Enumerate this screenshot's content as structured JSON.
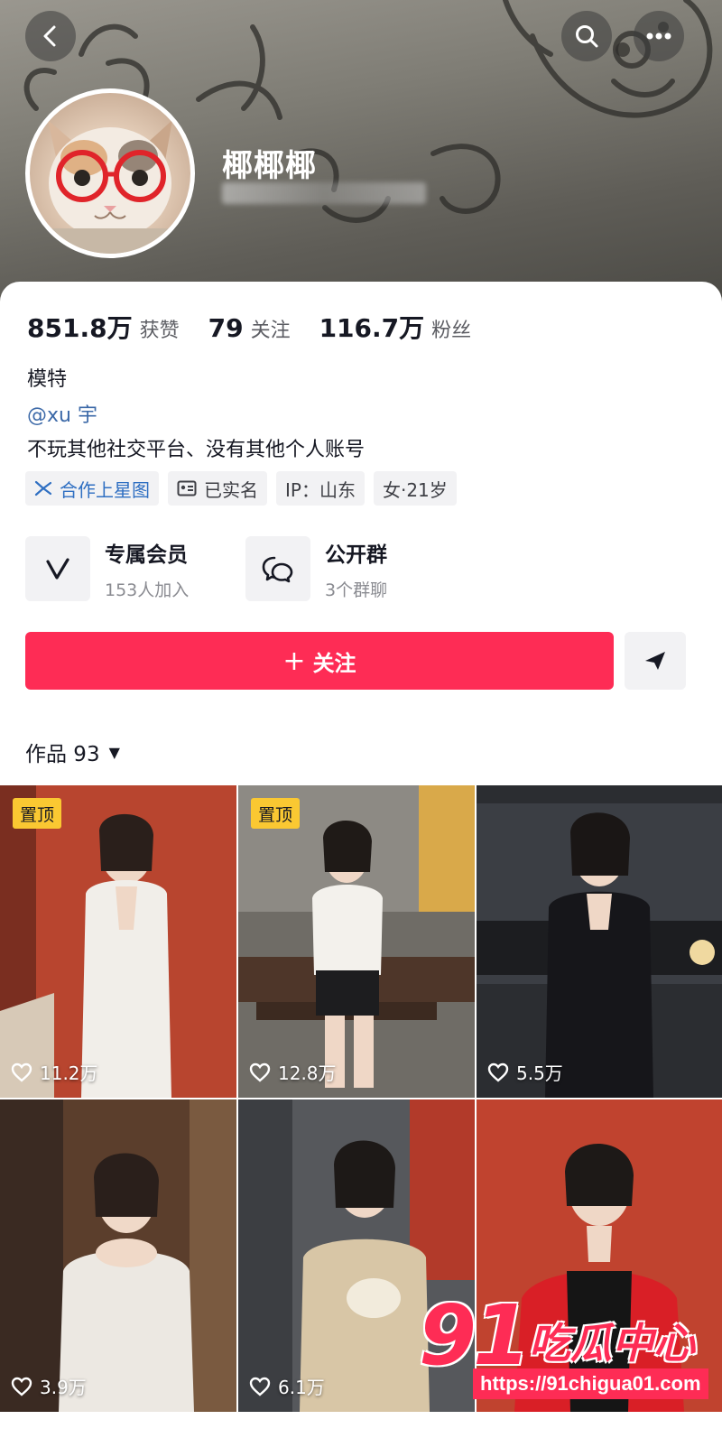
{
  "profile": {
    "nickname": "椰椰椰",
    "stats": [
      {
        "value": "851.8万",
        "label": "获赞"
      },
      {
        "value": "79",
        "label": "关注"
      },
      {
        "value": "116.7万",
        "label": "粉丝"
      }
    ],
    "bio_job": "模特",
    "bio_mention": "@xu 宇",
    "bio_line": "不玩其他社交平台、没有其他个人账号",
    "tags": [
      {
        "label": "合作上星图",
        "icon": "star-map-icon"
      },
      {
        "label": "已实名",
        "icon": "id-card-icon"
      },
      {
        "label": "IP：山东",
        "icon": ""
      },
      {
        "label": "女·21岁",
        "icon": ""
      }
    ]
  },
  "features": [
    {
      "title": "专属会员",
      "subtitle": "153人加入",
      "icon": "vip-v-icon"
    },
    {
      "title": "公开群",
      "subtitle": "3个群聊",
      "icon": "group-chat-icon"
    }
  ],
  "actions": {
    "follow_plus": "+",
    "follow_label": "关注"
  },
  "works": {
    "tab_label": "作品 93"
  },
  "videos": [
    {
      "pinned": "置顶",
      "likes": "11.2万"
    },
    {
      "pinned": "置顶",
      "likes": "12.8万"
    },
    {
      "pinned": "",
      "likes": "5.5万"
    },
    {
      "pinned": "",
      "likes": "3.9万"
    },
    {
      "pinned": "",
      "likes": "6.1万"
    },
    {
      "pinned": "",
      "likes": ""
    }
  ],
  "watermark": {
    "logo_number": "91",
    "logo_text": "吃瓜中心",
    "url": "https://91chigua01.com"
  },
  "colors": {
    "accent": "#fe2c55",
    "pin_badge": "#fac832",
    "mention": "#3c69a8",
    "star_tag": "#2f6fc2"
  }
}
